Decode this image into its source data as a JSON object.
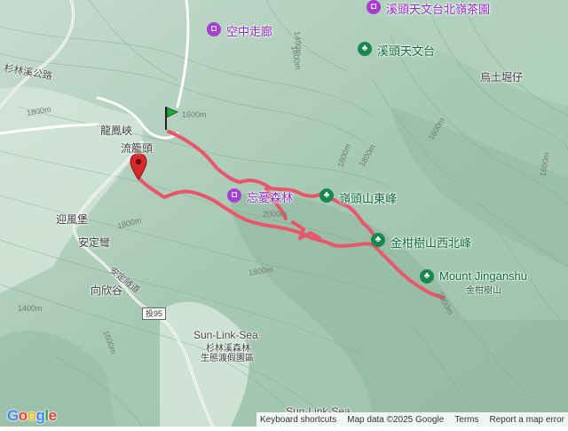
{
  "map": {
    "poi": {
      "sky_corridor": "空中走廊",
      "xitou_tea": "溪頭天文台北嶺茶園",
      "xitou_observatory": "溪頭天文台",
      "wangyou_forest": "忘憂森林",
      "linglou_east_peak": "嶺頭山東峰",
      "jinganshu_west_peak": "金柑樹山西北峰",
      "mount_jinganshu_en": "Mount Jinganshu",
      "mount_jinganshu_zh": "金柑樹山",
      "sun_link_sea_en": "Sun-Link-Sea",
      "sun_link_sea_zh1": "杉林溪森林",
      "sun_link_sea_zh2": "生態渡假園區",
      "sun_link_sea_bottom": "Sun-Link-Sea"
    },
    "places": {
      "longfeng_gorge": "龍鳳峽",
      "liulongtou": "流籠頭",
      "yingfeng_fort": "迎風堡",
      "anding_wan": "安定彎",
      "anding_tunnel": "安定隧道",
      "xiangxin_valley": "向欣谷",
      "wutukueizai": "烏土堀仔",
      "shanlinxi_road": "杉林溪公路"
    },
    "contours": {
      "c1600a": "1600m",
      "c1600b": "1600m",
      "c1800a": "1800m",
      "c1800b": "1800m",
      "c1800c": "1800m",
      "c1800d": "1800m",
      "c1800e": "1800m",
      "c2000a": "2000m",
      "c2000b": "2000m",
      "c1400a": "1400m",
      "c1400b": "1400m",
      "c1600c": "1600m",
      "c1600d": "1600m",
      "c1600e": "1600m"
    },
    "shield": "投95",
    "route_color": "#e8566a",
    "start_flag_color": "#1ea83a",
    "end_pin_color": "#d62b2b"
  },
  "footer": {
    "shortcuts": "Keyboard shortcuts",
    "map_data": "Map data ©2025 Google",
    "terms": "Terms",
    "report": "Report a map error"
  }
}
